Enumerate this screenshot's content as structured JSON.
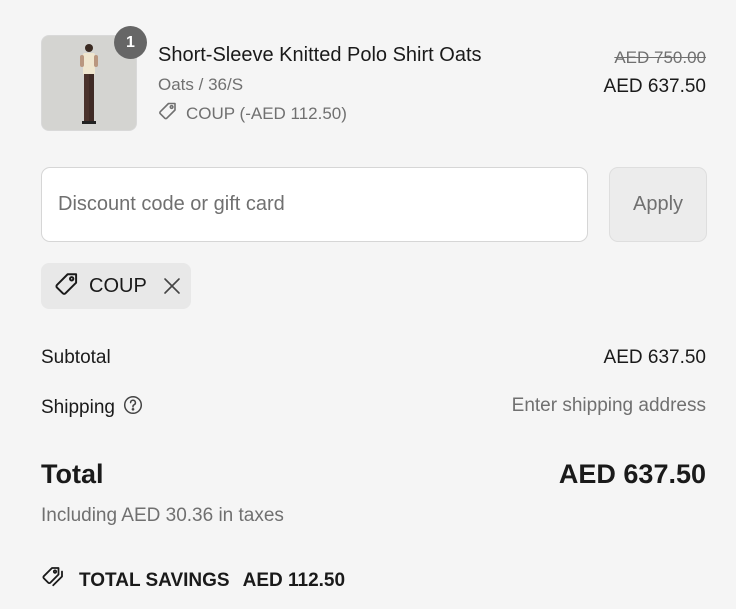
{
  "product": {
    "quantity": "1",
    "title": "Short-Sleeve Knitted Polo Shirt Oats",
    "variant": "Oats / 36/S",
    "discount_line": "COUP (-AED 112.50)",
    "original_price": "AED 750.00",
    "price": "AED 637.50",
    "discount_icon": "tag-icon",
    "image": "product-photo"
  },
  "discount": {
    "placeholder": "Discount code or gift card",
    "value": "",
    "apply_label": "Apply",
    "applied_code": "COUP",
    "code_icon": "tag-icon",
    "remove_icon": "close-icon"
  },
  "summary": {
    "subtotal_label": "Subtotal",
    "subtotal_value": "AED 637.50",
    "shipping_label": "Shipping",
    "shipping_help_icon": "question-circle-icon",
    "shipping_value": "Enter shipping address",
    "total_label": "Total",
    "total_value": "AED 637.50",
    "taxes_note": "Including AED 30.36 in taxes",
    "savings_label": "TOTAL SAVINGS",
    "savings_value": "AED 112.50",
    "savings_icon": "tags-icon"
  },
  "colors": {
    "background": "#f5f5f5",
    "text": "#1a1a1a",
    "muted": "#707070",
    "badge": "#666666"
  }
}
